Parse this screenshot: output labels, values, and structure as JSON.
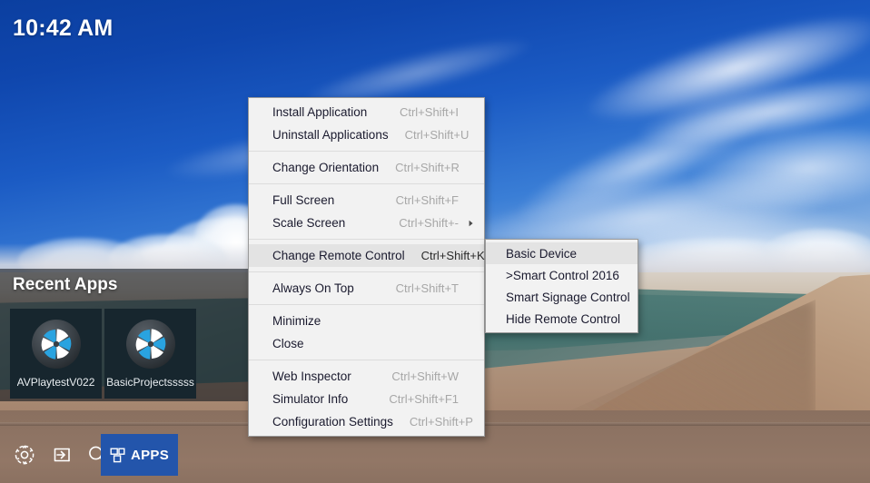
{
  "desktop": {
    "clock": "10:42 AM",
    "wallpaper_colors": {
      "sky": "#0f46ad",
      "sand": "#a9866c",
      "lagoon": "#4f7471"
    }
  },
  "recent_apps": {
    "title": "Recent Apps",
    "tiles": [
      {
        "label": "AVPlaytestV022",
        "icon": "pinwheel-app-icon"
      },
      {
        "label": "BasicProjectsssss",
        "icon": "pinwheel-app-icon"
      }
    ]
  },
  "taskbar": {
    "icons": [
      {
        "name": "gear-icon",
        "title": "Settings"
      },
      {
        "name": "login-arrow-icon",
        "title": "Sign In"
      },
      {
        "name": "search-icon",
        "title": "Search"
      }
    ],
    "apps_button": {
      "label": "APPS",
      "icon": "apps-grid-icon",
      "color": "#2355ab"
    }
  },
  "context_menu": {
    "groups": [
      {
        "items": [
          {
            "label": "Install Application",
            "shortcut": "Ctrl+Shift+I",
            "submenu": false,
            "highlighted": false
          },
          {
            "label": "Uninstall Applications",
            "shortcut": "Ctrl+Shift+U",
            "submenu": false,
            "highlighted": false
          }
        ]
      },
      {
        "items": [
          {
            "label": "Change Orientation",
            "shortcut": "Ctrl+Shift+R",
            "submenu": false,
            "highlighted": false
          }
        ]
      },
      {
        "items": [
          {
            "label": "Full Screen",
            "shortcut": "Ctrl+Shift+F",
            "submenu": false,
            "highlighted": false
          },
          {
            "label": "Scale Screen",
            "shortcut": "Ctrl+Shift+-",
            "submenu": true,
            "highlighted": false
          }
        ]
      },
      {
        "items": [
          {
            "label": "Change Remote Control",
            "shortcut": "Ctrl+Shift+K",
            "submenu": true,
            "highlighted": true
          }
        ]
      },
      {
        "items": [
          {
            "label": "Always On Top",
            "shortcut": "Ctrl+Shift+T",
            "submenu": false,
            "highlighted": false
          }
        ]
      },
      {
        "items": [
          {
            "label": "Minimize",
            "shortcut": "",
            "submenu": false,
            "highlighted": false
          },
          {
            "label": "Close",
            "shortcut": "",
            "submenu": false,
            "highlighted": false
          }
        ]
      },
      {
        "items": [
          {
            "label": "Web Inspector",
            "shortcut": "Ctrl+Shift+W",
            "submenu": false,
            "highlighted": false
          },
          {
            "label": "Simulator Info",
            "shortcut": "Ctrl+Shift+F1",
            "submenu": false,
            "highlighted": false
          },
          {
            "label": "Configuration Settings",
            "shortcut": "Ctrl+Shift+P",
            "submenu": false,
            "highlighted": false
          }
        ]
      }
    ]
  },
  "sub_menu": {
    "parent": "Change Remote Control",
    "items": [
      {
        "label": "Basic Device",
        "highlighted": true
      },
      {
        "label": ">Smart Control 2016",
        "highlighted": false
      },
      {
        "label": "Smart Signage Control",
        "highlighted": false
      },
      {
        "label": "Hide Remote Control",
        "highlighted": false
      }
    ]
  }
}
